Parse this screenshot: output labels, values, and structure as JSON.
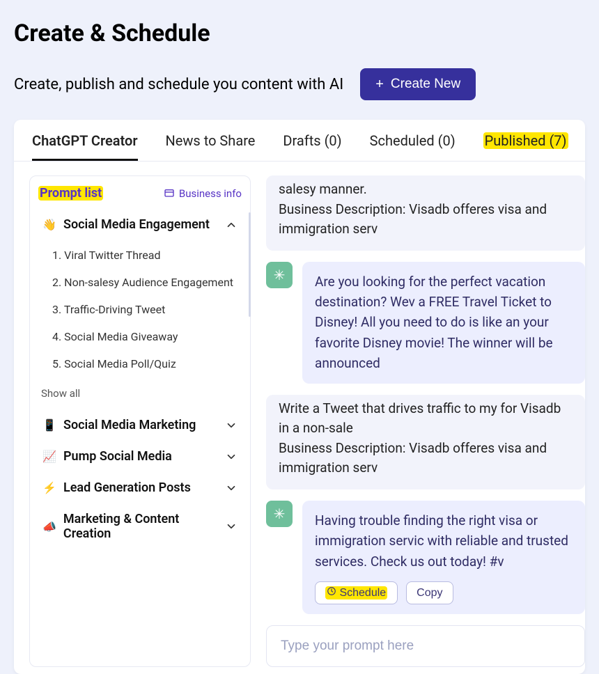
{
  "header": {
    "title": "Create & Schedule",
    "subtitle": "Create, publish and schedule you content with AI",
    "create_button": "Create New"
  },
  "tabs": {
    "chatgpt": "ChatGPT Creator",
    "news": "News to Share",
    "drafts": "Drafts (0)",
    "scheduled": "Scheduled (0)",
    "published": "Published (7)"
  },
  "sidebar": {
    "title": "Prompt list",
    "business_info": "Business info",
    "show_all": "Show all",
    "categories": [
      {
        "icon": "👋",
        "label": "Social Media Engagement",
        "expanded": true
      },
      {
        "icon": "📱",
        "label": "Social Media Marketing",
        "expanded": false
      },
      {
        "icon": "📈",
        "label": "Pump Social Media",
        "expanded": false
      },
      {
        "icon": "⚡",
        "label": "Lead Generation Posts",
        "expanded": false
      },
      {
        "icon": "📣",
        "label": "Marketing & Content Creation",
        "expanded": false
      }
    ],
    "sub_items": [
      "1. Viral Twitter Thread",
      "2. Non-salesy Audience Engagement",
      "3. Traffic-Driving Tweet",
      "4. Social Media Giveaway",
      "5. Social Media Poll/Quiz"
    ]
  },
  "chat": {
    "user1_a": "salesy manner.",
    "user1_b": "Business Description: Visadb offeres visa and immigration serv",
    "ai1": "Are you looking for the perfect vacation destination? Wev a FREE Travel Ticket to Disney! All you need to do is like an your favorite Disney movie! The winner will be announced",
    "user2_a": "Write a Tweet that drives traffic to my for Visadb in a non-sale",
    "user2_b": "Business Description: Visadb offeres visa and immigration serv",
    "ai2": "Having trouble finding the right visa or immigration servic with reliable and trusted services. Check us out today! #v",
    "schedule_btn": "Schedule",
    "copy_btn": "Copy",
    "input_placeholder": "Type your prompt here"
  }
}
